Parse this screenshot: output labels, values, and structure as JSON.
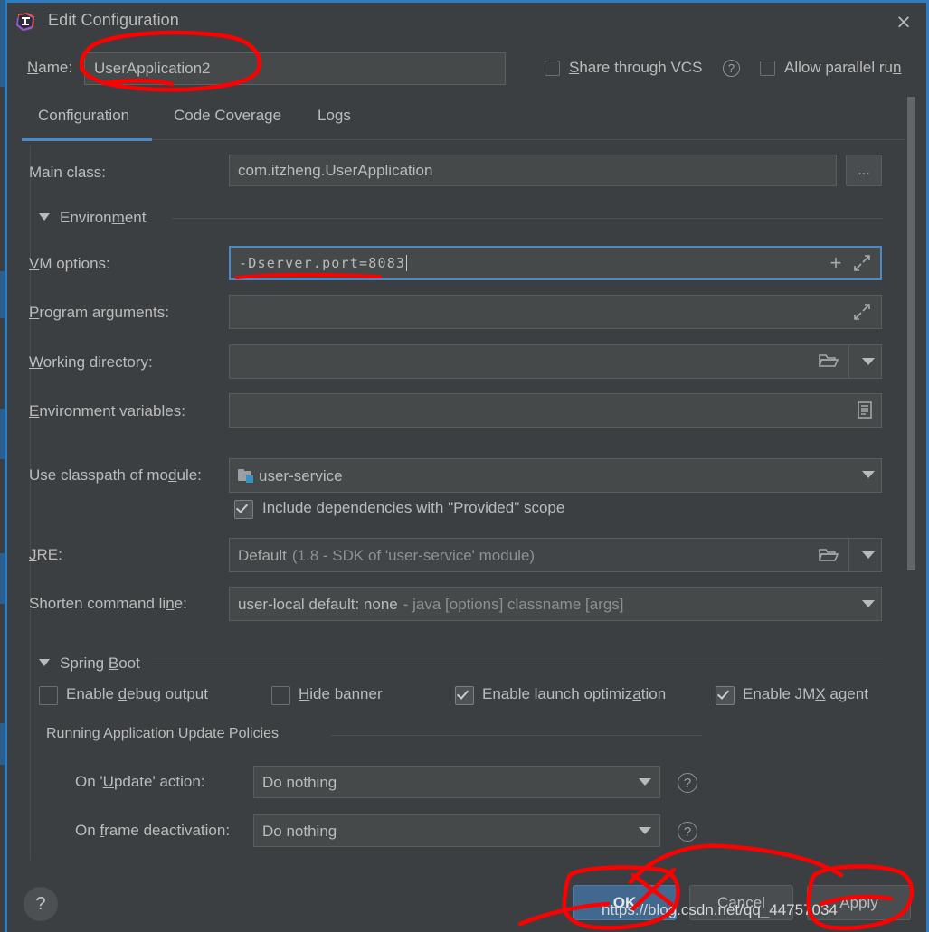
{
  "window": {
    "title": "Edit Configuration",
    "app_icon": "intellij-idea-icon",
    "close_icon": "×"
  },
  "name_row": {
    "label": "Name:",
    "label_mnemonic": "N",
    "value": "UserApplication2",
    "share_vcs": {
      "label": "Share through VCS",
      "mnemonic": "S",
      "checked": false
    },
    "share_vcs_help": "?",
    "allow_parallel": {
      "label": "Allow parallel run",
      "mnemonic": "n",
      "checked": false
    }
  },
  "tabs": [
    {
      "label": "Configuration",
      "active": true
    },
    {
      "label": "Code Coverage",
      "active": false
    },
    {
      "label": "Logs",
      "active": false
    }
  ],
  "form": {
    "main_class": {
      "label": "Main class:",
      "value": "com.itzheng.UserApplication",
      "browse_button": "..."
    },
    "environment_section": {
      "title": "Environment",
      "mnemonic": "m",
      "expanded": true
    },
    "vm_options": {
      "label": "VM options:",
      "mnemonic": "V",
      "value": "-Dserver.port=8083",
      "focused": true,
      "add_icon": "plus-icon",
      "expand_icon": "expand-arrows-icon"
    },
    "program_arguments": {
      "label": "Program arguments:",
      "mnemonic": "P",
      "value": "",
      "expand_icon": "expand-arrows-icon"
    },
    "working_directory": {
      "label": "Working directory:",
      "mnemonic": "W",
      "value": "",
      "folder_icon": "folder-icon",
      "dropdown_icon": "chevron-down-icon"
    },
    "environment_variables": {
      "label": "Environment variables:",
      "mnemonic": "E",
      "value": "",
      "list_icon": "document-list-icon"
    },
    "classpath_module": {
      "label": "Use classpath of module:",
      "mnemonic": "d",
      "value": "user-service",
      "module_icon": "module-folder-icon"
    },
    "include_provided": {
      "label": "Include dependencies with \"Provided\" scope",
      "checked": true
    },
    "jre": {
      "label": "JRE:",
      "mnemonic": "J",
      "value": "Default",
      "value_hint": "(1.8 - SDK of 'user-service' module)",
      "folder_icon": "folder-icon",
      "dropdown_icon": "chevron-down-icon"
    },
    "shorten_command_line": {
      "label": "Shorten command line:",
      "mnemonic": "n",
      "value": "user-local default: none",
      "value_hint": "- java [options] classname [args]",
      "dropdown_icon": "chevron-down-icon"
    }
  },
  "spring_boot": {
    "title": "Spring Boot",
    "mnemonic": "B",
    "expanded": true,
    "checkboxes": [
      {
        "label": "Enable debug output",
        "mnemonic": "d",
        "checked": false
      },
      {
        "label": "Hide banner",
        "mnemonic": "H",
        "checked": false
      },
      {
        "label": "Enable launch optimization",
        "mnemonic": "a",
        "checked": true
      },
      {
        "label": "Enable JMX agent",
        "mnemonic": "X",
        "checked": true
      }
    ],
    "update_policies": {
      "title": "Running Application Update Policies",
      "rows": [
        {
          "label": "On 'Update' action:",
          "mnemonic": "U",
          "value": "Do nothing",
          "help": "?"
        },
        {
          "label": "On frame deactivation:",
          "mnemonic": "f",
          "value": "Do nothing",
          "help": "?"
        }
      ]
    }
  },
  "footer": {
    "help_icon": "?",
    "ok": "OK",
    "cancel": "Cancel",
    "apply": "Apply"
  },
  "watermark": "https://blog.csdn.net/qq_44757034",
  "colors": {
    "accent_blue": "#4a88c7",
    "dialog_bg": "#3c3f41",
    "field_bg": "#45494a",
    "text": "#bbbbbb",
    "annotation_red": "#ff0000",
    "primary_button": "#41688f"
  }
}
